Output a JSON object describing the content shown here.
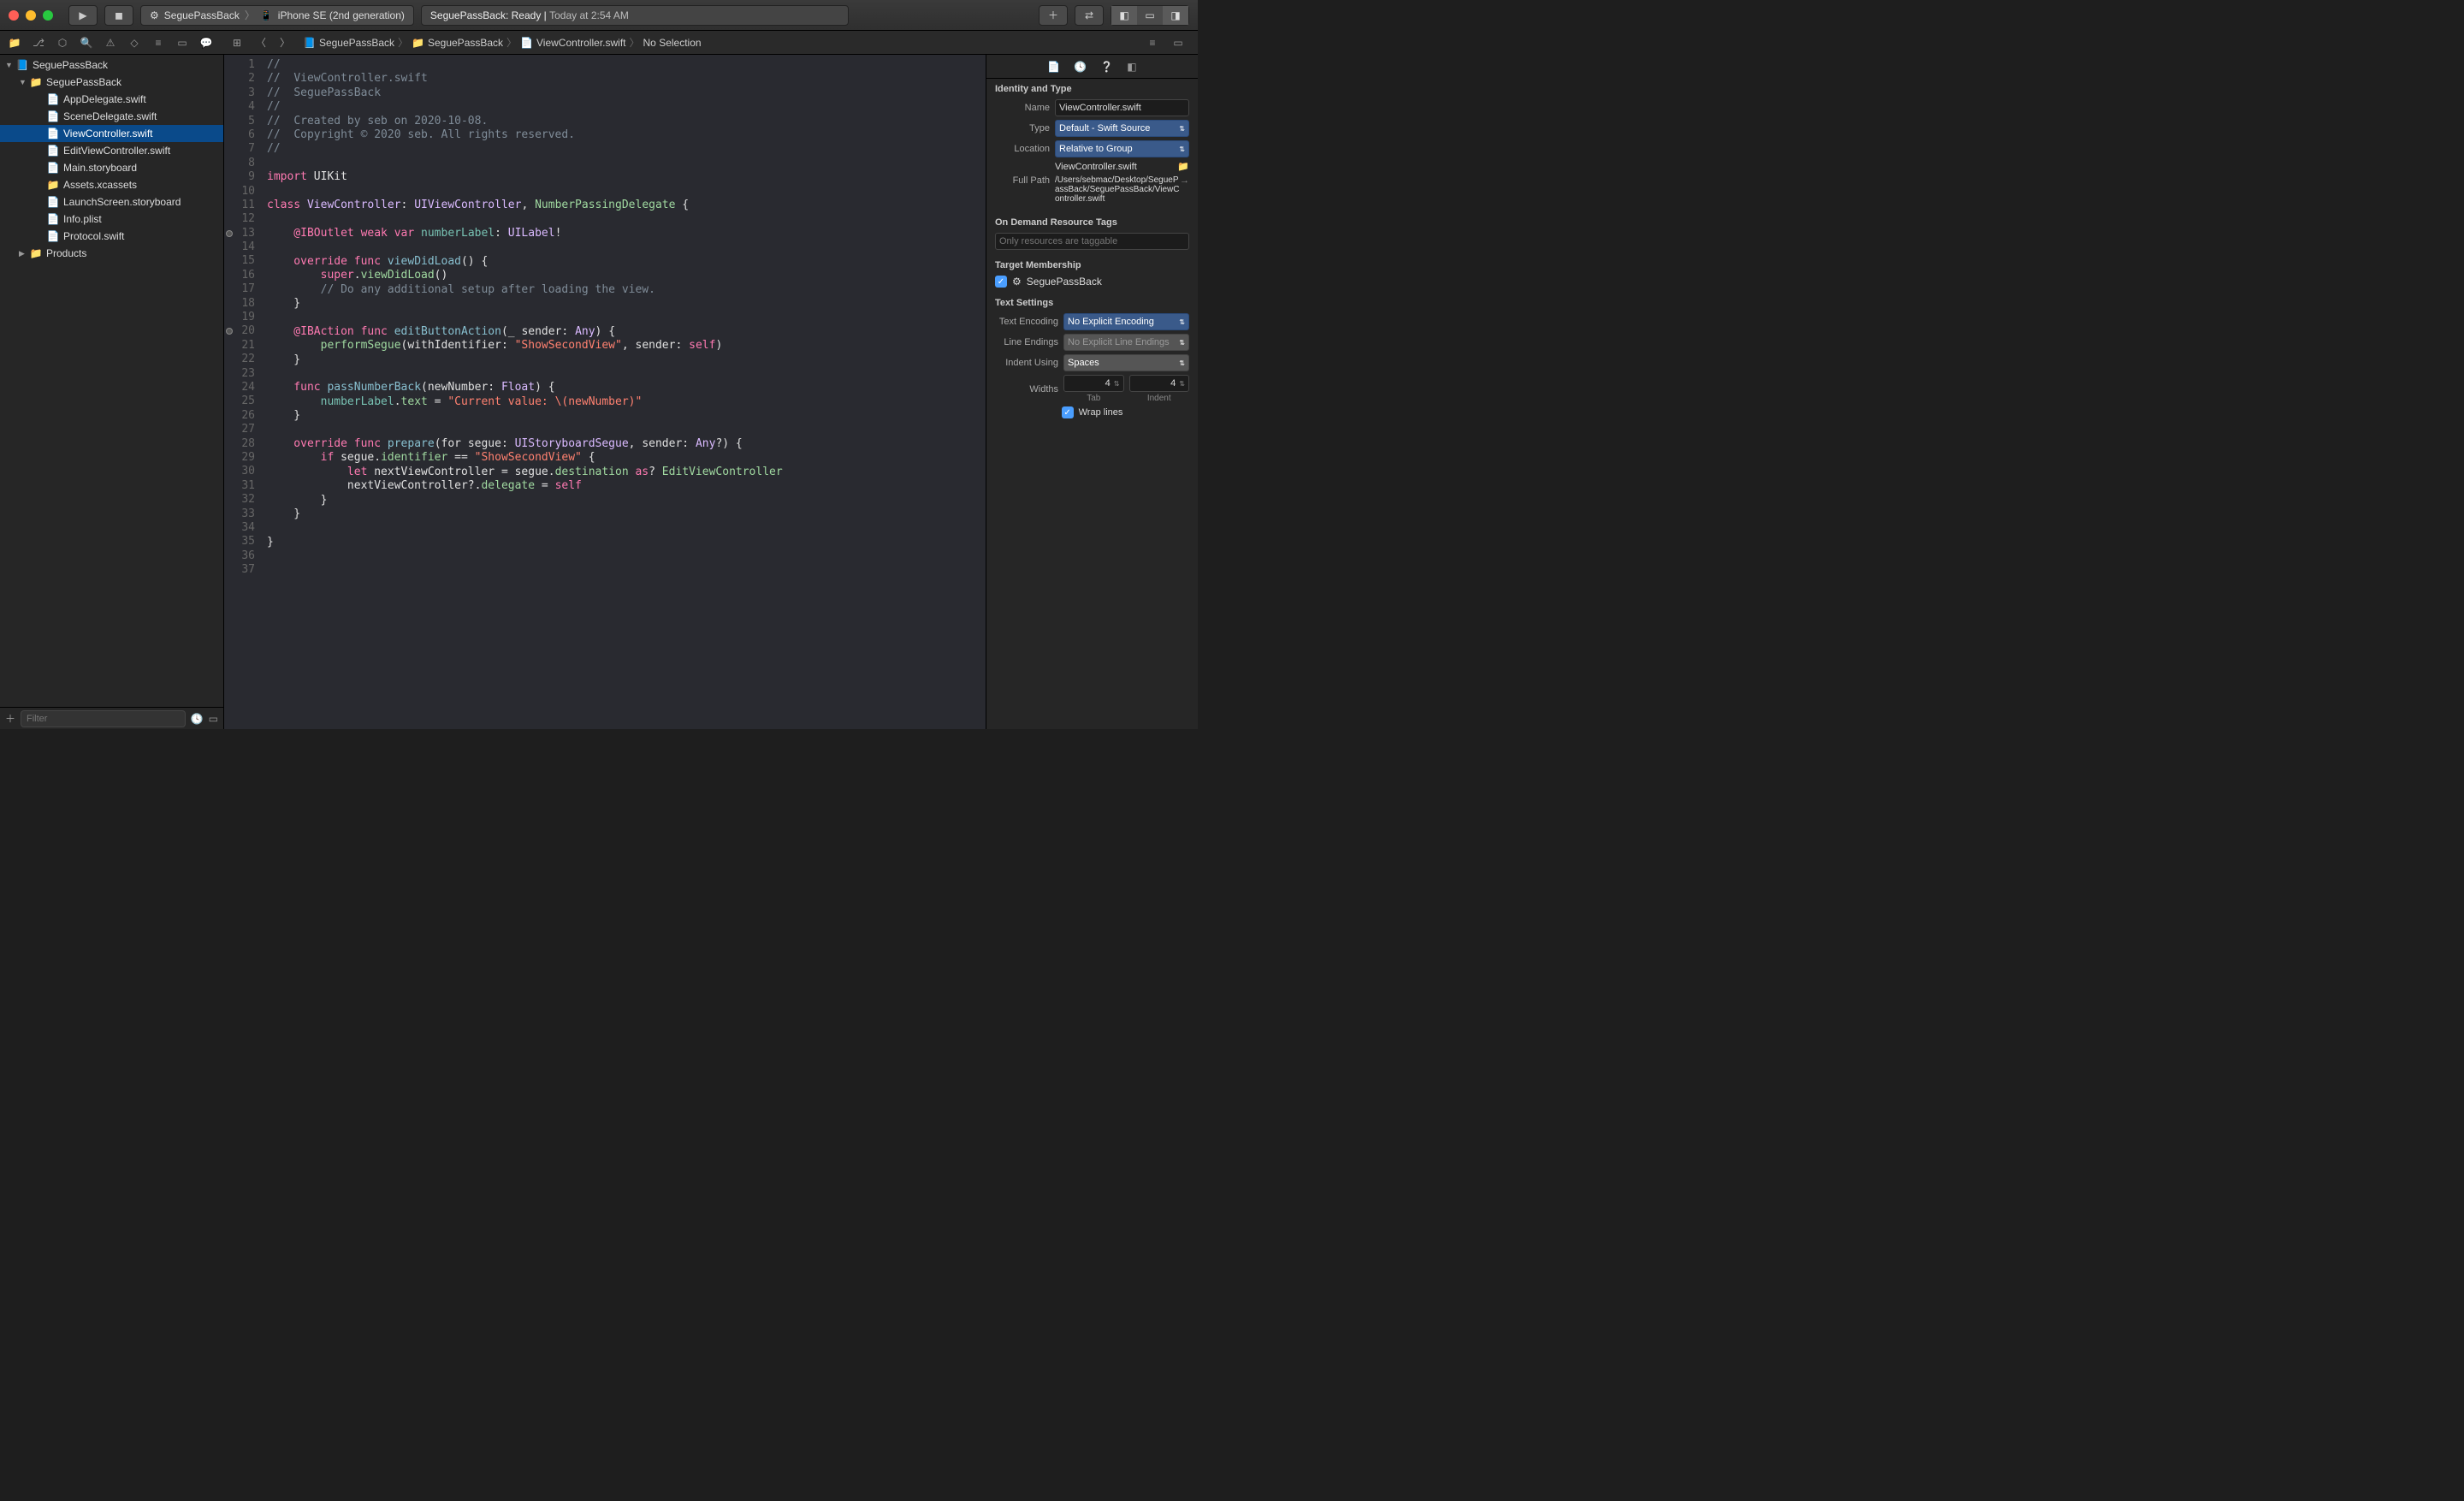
{
  "titlebar": {
    "scheme_app": "SeguePassBack",
    "scheme_device": "iPhone SE (2nd generation)",
    "status_app": "SeguePassBack:",
    "status_state": "Ready |",
    "status_time": "Today at 2:54 AM"
  },
  "breadcrumb": {
    "items": [
      "SeguePassBack",
      "SeguePassBack",
      "ViewController.swift",
      "No Selection"
    ]
  },
  "tree": {
    "root": "SeguePassBack",
    "group": "SeguePassBack",
    "files": [
      "AppDelegate.swift",
      "SceneDelegate.swift",
      "ViewController.swift",
      "EditViewController.swift",
      "Main.storyboard",
      "Assets.xcassets",
      "LaunchScreen.storyboard",
      "Info.plist",
      "Protocol.swift"
    ],
    "products": "Products"
  },
  "filter_placeholder": "Filter",
  "code": {
    "l1": "//",
    "l2a": "//  ",
    "l2b": "ViewController.swift",
    "l3a": "//  ",
    "l3b": "SeguePassBack",
    "l4": "//",
    "l5a": "//  ",
    "l5b": "Created by seb on 2020-10-08.",
    "l6a": "//  ",
    "l6b": "Copyright © 2020 seb. All rights reserved.",
    "l7": "//",
    "l9_import": "import",
    "l9_uikit": " UIKit",
    "l11_class": "class ",
    "l11_vc": "ViewController",
    "l11_colon": ": ",
    "l11_uivc": "UIViewController",
    "l11_comma": ", ",
    "l11_npd": "NumberPassingDelegate",
    "l11_brace": " {",
    "l13_outlet": "    @IBOutlet",
    "l13_weak": " weak",
    "l13_var": " var ",
    "l13_nl": "numberLabel",
    "l13_colon": ": ",
    "l13_uilabel": "UILabel",
    "l13_bang": "!",
    "l15_override": "    override",
    "l15_func": " func ",
    "l15_vdl": "viewDidLoad",
    "l15_parens": "() {",
    "l16_super": "        super",
    "l16_dot": ".",
    "l16_vdl": "viewDidLoad",
    "l16_parens": "()",
    "l17": "        // Do any additional setup after loading the view.",
    "l18": "    }",
    "l20_action": "    @IBAction",
    "l20_func": " func ",
    "l20_eba": "editButtonAction",
    "l20_paren": "(",
    "l20_under": "_ ",
    "l20_sender": "sender: ",
    "l20_any": "Any",
    "l20_close": ") {",
    "l21_perf": "        performSegue",
    "l21_paren": "(withIdentifier: ",
    "l21_str": "\"ShowSecondView\"",
    "l21_send": ", sender: ",
    "l21_self": "self",
    "l21_close": ")",
    "l22": "    }",
    "l24_func": "    func ",
    "l24_pnb": "passNumberBack",
    "l24_paren": "(newNumber: ",
    "l24_float": "Float",
    "l24_close": ") {",
    "l25_nl": "        numberLabel",
    "l25_dot": ".",
    "l25_text": "text",
    "l25_eq": " = ",
    "l25_str": "\"Current value: \\(newNumber)\"",
    "l26": "    }",
    "l28_override": "    override",
    "l28_func": " func ",
    "l28_prep": "prepare",
    "l28_paren": "(for segue: ",
    "l28_uisbs": "UIStoryboardSegue",
    "l28_send": ", sender: ",
    "l28_any": "Any",
    "l28_q": "?) {",
    "l29_if": "        if ",
    "l29_segue": "segue",
    "l29_dot": ".",
    "l29_ident": "identifier",
    "l29_eq": " == ",
    "l29_str": "\"ShowSecondView\"",
    "l29_brace": " {",
    "l30_let": "            let ",
    "l30_nvc": "nextViewController = segue",
    "l30_dot": ".",
    "l30_dest": "destination",
    "l30_as": " as",
    "l30_q": "? ",
    "l30_evc": "EditViewController",
    "l31_nvc": "            nextViewController?",
    "l31_dot": ".",
    "l31_del": "delegate",
    "l31_eq": " = ",
    "l31_self": "self",
    "l32": "        }",
    "l33": "    }",
    "l35": "}"
  },
  "inspector": {
    "identity_header": "Identity and Type",
    "name_lbl": "Name",
    "name_val": "ViewController.swift",
    "type_lbl": "Type",
    "type_val": "Default - Swift Source",
    "location_lbl": "Location",
    "location_val": "Relative to Group",
    "location_file": "ViewController.swift",
    "fullpath_lbl": "Full Path",
    "fullpath_val": "/Users/sebmac/Desktop/SeguePassBack/SeguePassBack/ViewController.swift",
    "tags_header": "On Demand Resource Tags",
    "tags_placeholder": "Only resources are taggable",
    "membership_header": "Target Membership",
    "membership_target": "SeguePassBack",
    "text_header": "Text Settings",
    "encoding_lbl": "Text Encoding",
    "encoding_val": "No Explicit Encoding",
    "lineendings_lbl": "Line Endings",
    "lineendings_val": "No Explicit Line Endings",
    "indent_lbl": "Indent Using",
    "indent_val": "Spaces",
    "widths_lbl": "Widths",
    "tab_width": "4",
    "indent_width": "4",
    "tab_sublabel": "Tab",
    "indent_sublabel": "Indent",
    "wrap_lbl": "Wrap lines"
  }
}
